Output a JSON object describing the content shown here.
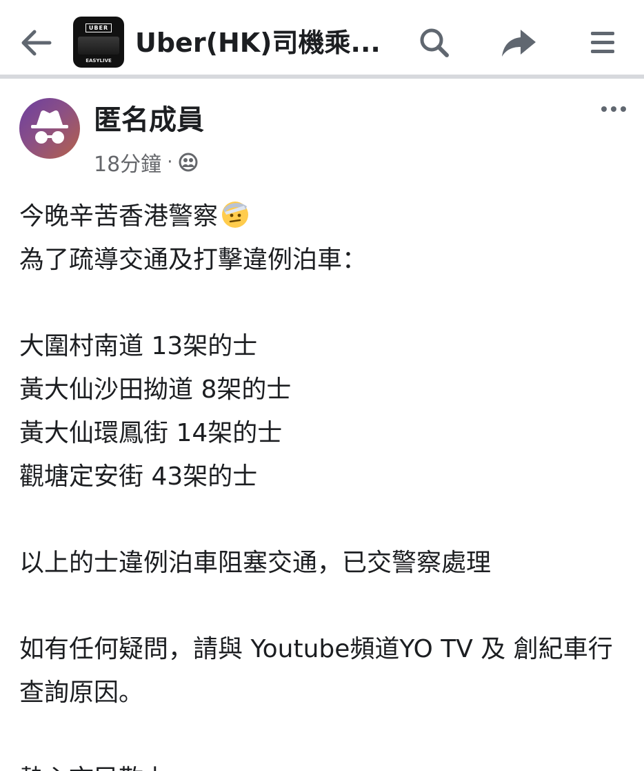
{
  "header": {
    "back_label": "back",
    "group_thumbnail": {
      "logo_text": "UBER",
      "caption": "EASYLIVE"
    },
    "title": "Uber(HK)司機乘...",
    "icons": {
      "back": "arrow-left-icon",
      "search": "search-icon",
      "share": "share-icon",
      "menu": "hamburger-menu-icon"
    }
  },
  "post": {
    "author": "匿名成員",
    "avatar_icon": "anonymous-incognito-icon",
    "time": "18分鐘",
    "separator": "·",
    "audience_icon": "group-audience-icon",
    "more_icon": "more-dots-icon",
    "paragraphs": [
      {
        "lines": [
          "今晚辛苦香港警察",
          "為了疏導交通及打擊違例泊車："
        ],
        "emoji": "saluting-face-emoji"
      },
      {
        "lines": [
          "大圍村南道 13架的士",
          "黃大仙沙田拗道 8架的士",
          "黃大仙環鳳街 14架的士",
          "觀塘定安街 43架的士"
        ]
      },
      {
        "lines": [
          "以上的士違例泊車阻塞交通，已交警察處理"
        ]
      },
      {
        "text": "如有任何疑問，請與 Youtube頻道YO TV 及 創紀車行 查詢原因。"
      },
      {
        "lines": [
          "熱心市民敬上"
        ]
      }
    ]
  },
  "colors": {
    "background": "#ffffff",
    "text_primary": "#1c1e21",
    "text_secondary": "#65676b",
    "icon_gray": "#606770",
    "divider": "#d7d9dd"
  }
}
